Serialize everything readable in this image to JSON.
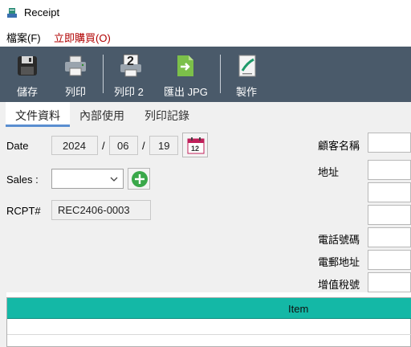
{
  "window": {
    "title": "Receipt"
  },
  "menu": {
    "file": "檔案(F)",
    "buy_now": "立即購買(O)"
  },
  "toolbar": {
    "save": "儲存",
    "print": "列印",
    "print2": "列印 2",
    "print2_badge": "2",
    "export_jpg": "匯出 JPG",
    "make": "製作"
  },
  "tabs": [
    {
      "label": "文件資料",
      "active": true
    },
    {
      "label": "內部使用",
      "active": false
    },
    {
      "label": "列印記錄",
      "active": false
    }
  ],
  "form": {
    "date_label": "Date",
    "year": "2024",
    "month": "06",
    "day": "19",
    "date_sep": "/",
    "calendar_badge": "12",
    "sales_label": "Sales :",
    "sales_value": "",
    "rcpt_label": "RCPT#",
    "rcpt_value": "REC2406-0003",
    "customer_name_label": "顧客名稱",
    "address_label": "地址",
    "phone_label": "電話號碼",
    "email_label": "電郵地址",
    "vat_label": "增值稅號"
  },
  "grid": {
    "columns": [
      "Item"
    ]
  },
  "colors": {
    "toolbar_bg": "#4a5a6a",
    "grid_header": "#14b8a6",
    "buy_menu": "#b00000",
    "tab_accent": "#5a8ed0"
  },
  "icons": [
    "receipt-app-icon",
    "save-icon",
    "printer-icon",
    "printer-2-icon",
    "export-jpg-icon",
    "make-icon",
    "calendar-icon",
    "add-icon",
    "chevron-down-icon"
  ]
}
